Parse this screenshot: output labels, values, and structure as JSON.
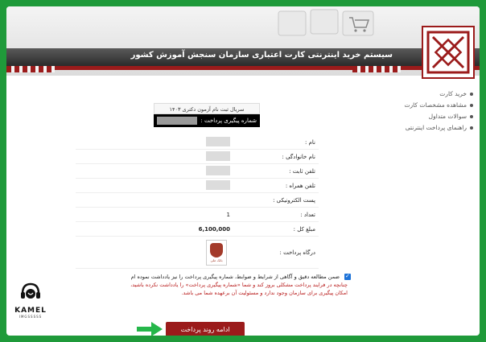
{
  "header": {
    "title": "سیستم خرید اینترنتی کارت اعتباری سازمان سنجش آموزش کشور"
  },
  "sidebar": {
    "items": [
      {
        "label": "خرید کارت"
      },
      {
        "label": "مشاهده مشخصات کارت"
      },
      {
        "label": "سوالات متداول"
      },
      {
        "label": "راهنمای پرداخت اینترنتی"
      }
    ]
  },
  "order": {
    "serial_label": "سریال ثبت نام آزمون دکتری ۱۴۰۳",
    "tracking_label": "شماره پیگیری پرداخت :"
  },
  "form": {
    "name_label": "نام :",
    "family_label": "نام خانوادگی :",
    "phone_label": "تلفن ثابت :",
    "mobile_label": "تلفن همراه :",
    "email_label": "پست الکترونیکی :",
    "count_label": "تعداد :",
    "count_value": "1",
    "total_label": "مبلغ کل :",
    "total_value": "6,100,000",
    "gateway_label": "درگاه پرداخت :"
  },
  "agreement": {
    "text": "ضمن مطالعه دقیق و آگاهی از شرایط و ضوابط، شماره پیگیری پرداخت را نیز یادداشت نموده ام",
    "warning1": "چنانچه در فرایند پرداخت مشکلی بروز کند و شما «شماره پیگیری پرداخت» را یادداشت نکرده باشید،",
    "warning2": "امکان پیگیری برای سازمان وجود ندارد و مسئولیت آن برعهده شما می باشد."
  },
  "pay_button": "ادامه روند پرداخت",
  "watermark": {
    "brand": "KAMEL",
    "sub": "IMGSSSSS"
  },
  "colors": {
    "accent": "#9b1b1b",
    "frame": "#1f9a3a"
  }
}
